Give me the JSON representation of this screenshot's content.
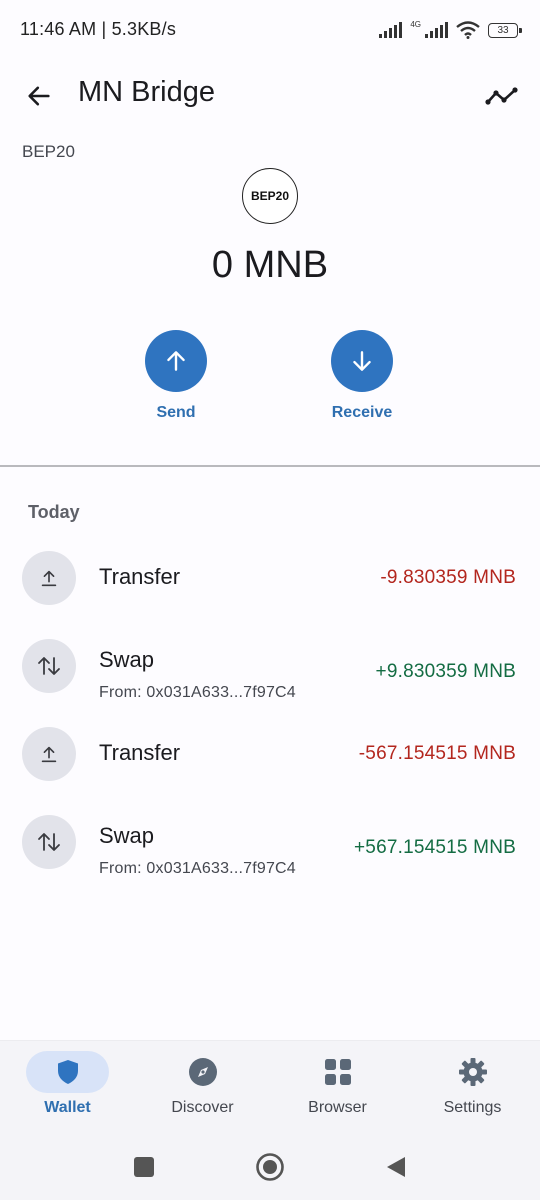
{
  "status_bar": {
    "time_speed": "11:46 AM | 5.3KB/s",
    "network_type": "4G",
    "battery": "33"
  },
  "header": {
    "title": "MN Bridge"
  },
  "token": {
    "network": "BEP20",
    "logo_text": "BEP20",
    "balance": "0 MNB"
  },
  "actions": {
    "send_label": "Send",
    "receive_label": "Receive"
  },
  "transactions": {
    "section_label": "Today",
    "items": [
      {
        "type": "Transfer",
        "sub": "",
        "amount": "-9.830359 MNB",
        "direction": "out",
        "icon": "upload-icon"
      },
      {
        "type": "Swap",
        "sub": "From: 0x031A633...7f97C4",
        "amount": "+9.830359 MNB",
        "direction": "in",
        "icon": "swap-arrows-icon"
      },
      {
        "type": "Transfer",
        "sub": "",
        "amount": "-567.154515 MNB",
        "direction": "out",
        "icon": "upload-icon"
      },
      {
        "type": "Swap",
        "sub": "From: 0x031A633...7f97C4",
        "amount": "+567.154515 MNB",
        "direction": "in",
        "icon": "swap-arrows-icon"
      }
    ]
  },
  "bottom_nav": {
    "items": [
      {
        "label": "Wallet",
        "icon": "shield-icon",
        "active": true
      },
      {
        "label": "Discover",
        "icon": "compass-icon",
        "active": false
      },
      {
        "label": "Browser",
        "icon": "grid-icon",
        "active": false
      },
      {
        "label": "Settings",
        "icon": "gear-icon",
        "active": false
      }
    ]
  },
  "colors": {
    "accent": "#2f74c0",
    "negative": "#b3261e",
    "positive": "#146c43"
  }
}
